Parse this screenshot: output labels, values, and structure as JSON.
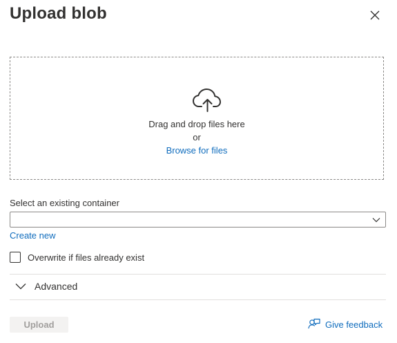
{
  "panel": {
    "title": "Upload blob"
  },
  "dropzone": {
    "line1": "Drag and drop files here",
    "line2": "or",
    "browse_label": "Browse for files"
  },
  "container_select": {
    "label": "Select an existing container",
    "value": "",
    "create_new_label": "Create new"
  },
  "overwrite": {
    "label": "Overwrite if files already exist",
    "checked": false
  },
  "advanced": {
    "label": "Advanced",
    "expanded": false
  },
  "footer": {
    "upload_label": "Upload",
    "upload_enabled": false,
    "feedback_label": "Give feedback"
  },
  "icons": {
    "close": "close-icon",
    "upload": "cloud-upload-icon",
    "select_chevron": "chevron-down-icon",
    "advanced_chevron": "chevron-down-icon",
    "feedback": "feedback-icon"
  },
  "colors": {
    "link": "#0f6cbd",
    "text": "#323130",
    "border": "#8a8886",
    "divider": "#e1dfdd",
    "disabled_bg": "#f3f2f1",
    "disabled_text": "#a19f9d"
  }
}
